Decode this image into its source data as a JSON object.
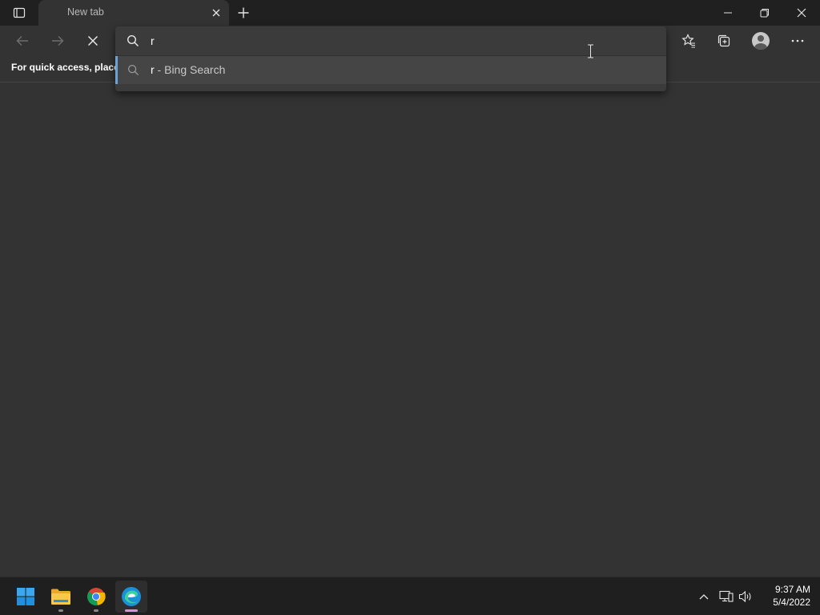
{
  "tab": {
    "title": "New tab"
  },
  "favorites_bar": {
    "text": "For quick access, place y"
  },
  "address": {
    "value": "r"
  },
  "suggestion": {
    "query": "r",
    "suffix": " - Bing Search"
  },
  "taskbar": {
    "apps": [
      "start-menu",
      "file-explorer",
      "google-chrome",
      "microsoft-edge"
    ]
  },
  "clock": {
    "time": "9:37 AM",
    "date": "5/4/2022"
  },
  "colors": {
    "background": "#333333",
    "titlebar": "#202020",
    "taskbar": "#1f1f1f",
    "suggestion_accent": "#6aa3d8"
  }
}
